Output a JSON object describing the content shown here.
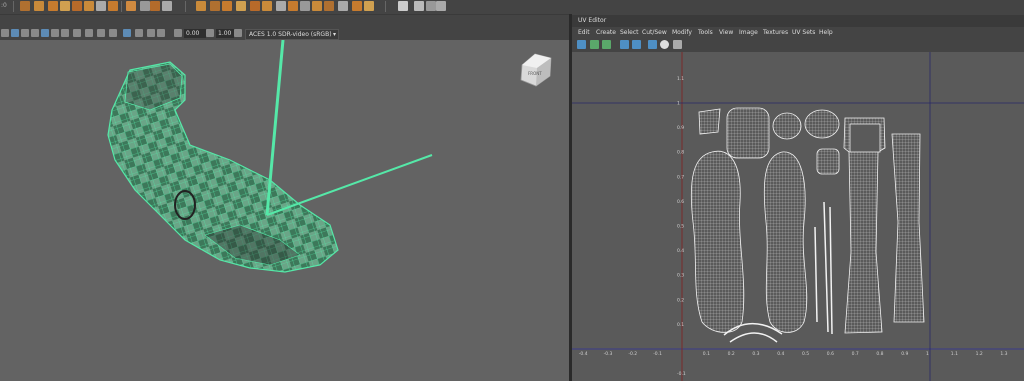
{
  "viewport": {
    "num_field_1": "0.00",
    "num_field_2": "1.00",
    "color_space": "ACES 1.0 SDR-video (sRGB)",
    "view_cube_label": "FRONT"
  },
  "uv_editor": {
    "title": "UV Editor",
    "menus": [
      "Edit",
      "Create",
      "Select",
      "Cut/Sew",
      "Modify",
      "Tools",
      "View",
      "Image",
      "Textures",
      "UV Sets",
      "Help"
    ],
    "x_ticks": [
      "-0.4",
      "-0.3",
      "-0.2",
      "-0.1",
      "0.1",
      "0.2",
      "0.3",
      "0.4",
      "0.5",
      "0.6",
      "0.7",
      "0.8",
      "0.9",
      "1",
      "1.1",
      "1.2",
      "1.3"
    ],
    "y_ticks": [
      "1.1",
      "1",
      "0.9",
      "0.8",
      "0.7",
      "0.6",
      "0.5",
      "0.4",
      "0.3",
      "0.2",
      "0.1",
      "-0.1"
    ]
  },
  "colors": {
    "accent_green": "#55e8a8",
    "tile_dark": "#3c3c3c",
    "tile_light": "#8e8e8e",
    "mesh_fill": "#3fc07f"
  }
}
